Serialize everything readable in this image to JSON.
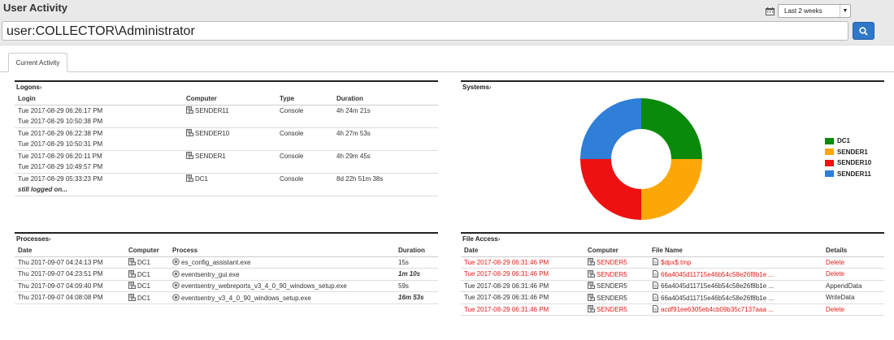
{
  "header": {
    "title": "User Activity",
    "date_range": "Last 2 weeks",
    "search_value": "user:COLLECTOR\\Administrator"
  },
  "tabs": [
    {
      "label": "Current Activity"
    }
  ],
  "logons": {
    "title": "Logons",
    "columns": [
      "Login",
      "Computer",
      "Type",
      "Duration"
    ],
    "rows": [
      {
        "login": "Tue 2017-08-29 06:26:17 PM",
        "logout": "Tue 2017-08-29 10:50:38 PM",
        "computer": "SENDER11",
        "type": "Console",
        "duration": "4h 24m 21s"
      },
      {
        "login": "Tue 2017-08-29 06:22:38 PM",
        "logout": "Tue 2017-08-29 10:50:31 PM",
        "computer": "SENDER10",
        "type": "Console",
        "duration": "4h 27m 53s"
      },
      {
        "login": "Tue 2017-08-29 06:20:11 PM",
        "logout": "Tue 2017-08-29 10:49:57 PM",
        "computer": "SENDER1",
        "type": "Console",
        "duration": "4h 29m 45s"
      },
      {
        "login": "Tue 2017-08-29 05:33:23 PM",
        "logout": "still logged on...",
        "computer": "DC1",
        "type": "Console",
        "duration": "8d 22h 51m 38s"
      }
    ]
  },
  "systems": {
    "title": "Systems"
  },
  "processes": {
    "title": "Processes",
    "columns": [
      "Date",
      "Computer",
      "Process",
      "Duration"
    ],
    "rows": [
      {
        "date": "Thu 2017-09-07 04:24:13 PM",
        "computer": "DC1",
        "process": "es_config_assistant.exe",
        "duration": "15s"
      },
      {
        "date": "Thu 2017-09-07 04:23:51 PM",
        "computer": "DC1",
        "process": "eventsentry_gui.exe",
        "duration": "1m 10s"
      },
      {
        "date": "Thu 2017-09-07 04:09:40 PM",
        "computer": "DC1",
        "process": "eventsentry_webreports_v3_4_0_90_windows_setup.exe",
        "duration": "59s"
      },
      {
        "date": "Thu 2017-09-07 04:08:08 PM",
        "computer": "DC1",
        "process": "eventsentry_v3_4_0_90_windows_setup.exe",
        "duration": "16m 53s"
      }
    ]
  },
  "file_access": {
    "title": "File Access",
    "columns": [
      "Date",
      "Computer",
      "File Name",
      "Details"
    ],
    "rows": [
      {
        "date": "Tue 2017-08-29 06:31:46 PM",
        "computer": "SENDER5",
        "file": "$dpx$.tmp",
        "details": "Delete"
      },
      {
        "date": "Tue 2017-08-29 06:31:46 PM",
        "computer": "SENDER5",
        "file": "66a4045d11715e46b54c58e26f8b1e ...",
        "details": "Delete"
      },
      {
        "date": "Tue 2017-08-29 06:31:46 PM",
        "computer": "SENDER5",
        "file": "66a4045d11715e46b54c58e26f8b1e ...",
        "details": "AppendData"
      },
      {
        "date": "Tue 2017-08-29 06:31:46 PM",
        "computer": "SENDER5",
        "file": "66a4045d11715e46b54c58e26f8b1e ...",
        "details": "WriteData"
      },
      {
        "date": "Tue 2017-08-29 06:31:46 PM",
        "computer": "SENDER5",
        "file": "acdf91ee6305eb4cb09b35c7137aaa ...",
        "details": "Delete"
      }
    ]
  },
  "chart_data": {
    "type": "pie",
    "donut": true,
    "categories": [
      "DC1",
      "SENDER1",
      "SENDER10",
      "SENDER11"
    ],
    "values": [
      25,
      25,
      25,
      25
    ],
    "colors": [
      "#0a8a0a",
      "#fca708",
      "#ee1111",
      "#2f7ed8"
    ],
    "legend": "right",
    "title": ""
  },
  "colors": {
    "accent": "#2e77c9",
    "delete_red": "#e0201b"
  },
  "icons": {
    "calendar": "calendar-icon",
    "search": "search-icon",
    "computer": "computer-icon",
    "process": "gear-icon",
    "file": "file-icon"
  }
}
